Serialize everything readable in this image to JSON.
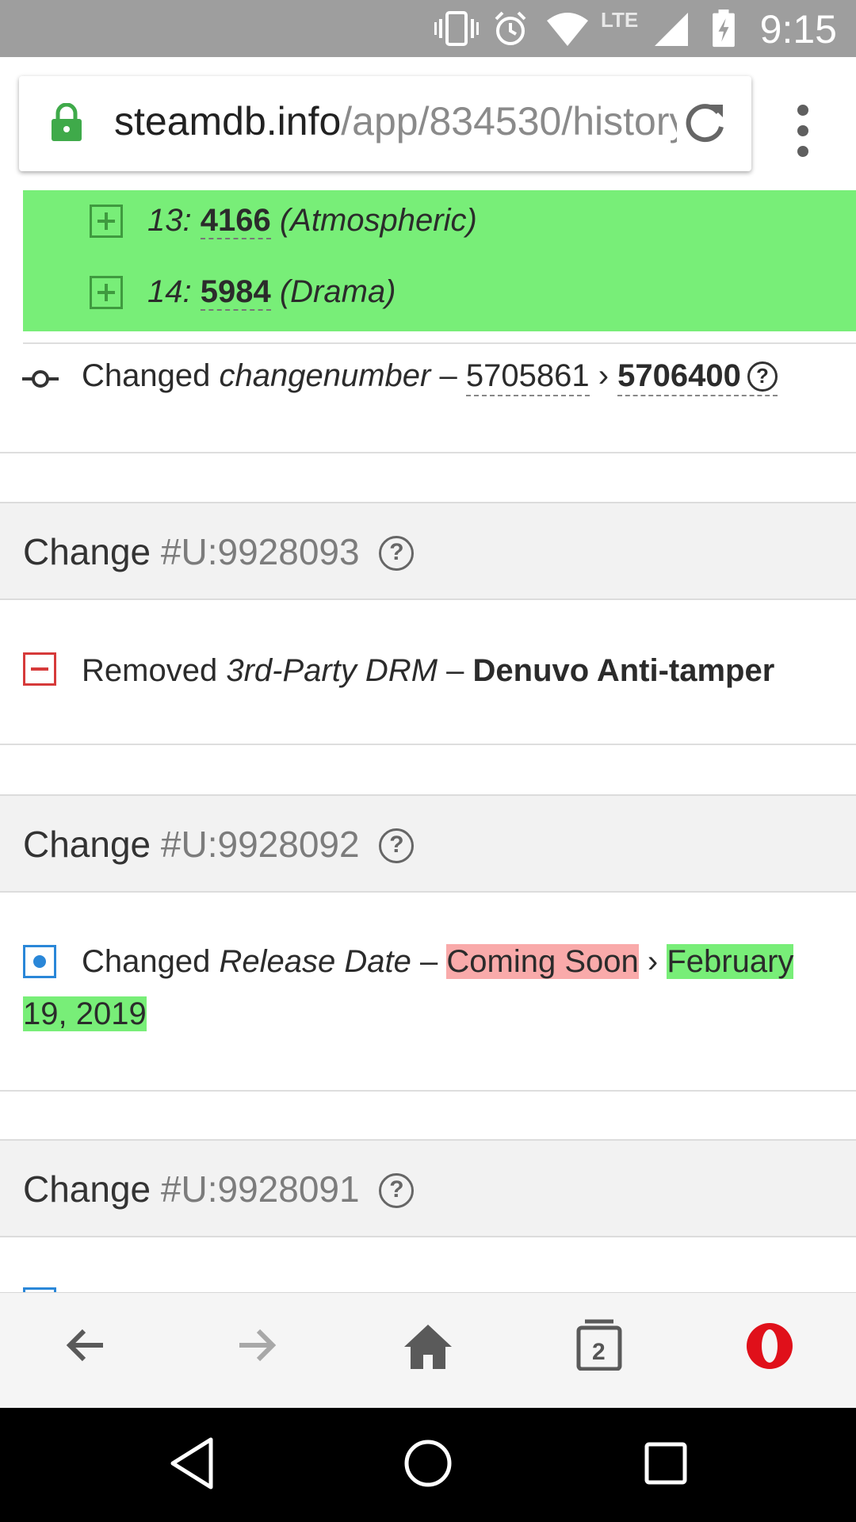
{
  "status_bar": {
    "time": "9:15",
    "network": "LTE"
  },
  "address_bar": {
    "host": "steamdb.info",
    "path": "/app/834530/history"
  },
  "top_list": {
    "items": [
      {
        "index": "13:",
        "id": "4166",
        "tag": "(Atmospheric)"
      },
      {
        "index": "14:",
        "id": "5984",
        "tag": "(Drama)"
      }
    ]
  },
  "changenumber_row": {
    "verb": "Changed",
    "field": "changenumber",
    "sep": "–",
    "old": "5705861",
    "arrow": "›",
    "new": "5706400",
    "help": "?"
  },
  "changes": [
    {
      "label": "Change",
      "id": "#U:9928093",
      "help": "?"
    },
    {
      "label": "Change",
      "id": "#U:9928092",
      "help": "?"
    },
    {
      "label": "Change",
      "id": "#U:9928091",
      "help": "?"
    }
  ],
  "removed_row": {
    "verb": "Removed",
    "field": "3rd-Party DRM",
    "sep": "–",
    "value": "Denuvo Anti-tamper"
  },
  "release_row": {
    "verb": "Changed",
    "field": "Release Date",
    "sep": "–",
    "old": "Coming Soon",
    "arrow": "›",
    "new_part1": "February",
    "new_part2": "19, 2019"
  },
  "bottom_nav": {
    "tab_count": "2"
  },
  "colors": {
    "added": "#78ee78",
    "removed_highlight": "#f9aaaa",
    "removed_icon": "#d63a3a",
    "changed_icon": "#2a87d8",
    "opera_red": "#e0101a",
    "lock_green": "#3faa4a"
  },
  "icons": [
    "vibrate-icon",
    "alarm-icon",
    "wifi-icon",
    "signal-icon",
    "battery-charging-icon",
    "lock-icon",
    "reload-icon",
    "overflow-menu-icon",
    "plus-icon",
    "commit-icon",
    "help-icon",
    "minus-icon",
    "changed-icon",
    "back-icon",
    "forward-icon",
    "home-icon",
    "tabs-icon",
    "opera-icon",
    "nav-back-icon",
    "nav-home-icon",
    "nav-recents-icon"
  ]
}
